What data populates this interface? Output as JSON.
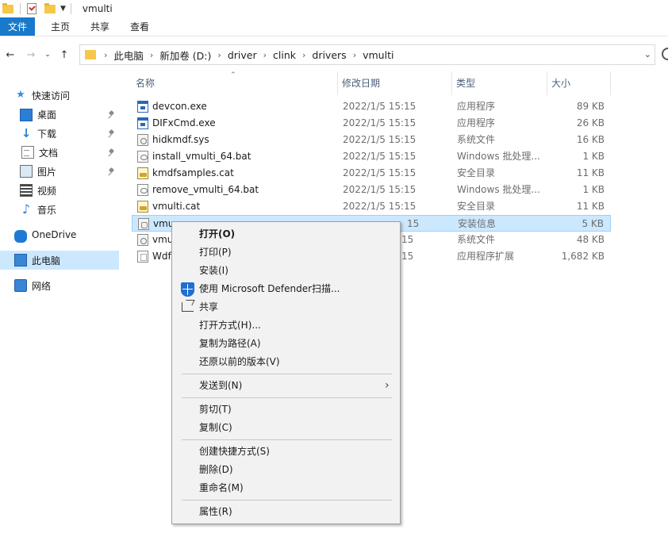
{
  "window": {
    "title": "vmulti"
  },
  "ribbon": {
    "tabs": [
      "文件",
      "主页",
      "共享",
      "查看"
    ]
  },
  "address": {
    "crumbs": [
      "此电脑",
      "新加卷 (D:)",
      "driver",
      "clink",
      "drivers",
      "vmulti"
    ]
  },
  "sidebar": {
    "quick_access": "快速访问",
    "items": [
      "桌面",
      "下载",
      "文档",
      "图片",
      "视频",
      "音乐"
    ],
    "onedrive": "OneDrive",
    "this_pc": "此电脑",
    "network": "网络"
  },
  "columns": {
    "name": "名称",
    "date": "修改日期",
    "type": "类型",
    "size": "大小"
  },
  "files": [
    {
      "name": "devcon.exe",
      "date": "2022/1/5 15:15",
      "type": "应用程序",
      "size": "89 KB",
      "icon": "exe-icon"
    },
    {
      "name": "DIFxCmd.exe",
      "date": "2022/1/5 15:15",
      "type": "应用程序",
      "size": "26 KB",
      "icon": "exe-icon"
    },
    {
      "name": "hidkmdf.sys",
      "date": "2022/1/5 15:15",
      "type": "系统文件",
      "size": "16 KB",
      "icon": "sys-icon"
    },
    {
      "name": "install_vmulti_64.bat",
      "date": "2022/1/5 15:15",
      "type": "Windows 批处理...",
      "size": "1 KB",
      "icon": "bat-icon"
    },
    {
      "name": "kmdfsamples.cat",
      "date": "2022/1/5 15:15",
      "type": "安全目录",
      "size": "11 KB",
      "icon": "cat-icon"
    },
    {
      "name": "remove_vmulti_64.bat",
      "date": "2022/1/5 15:15",
      "type": "Windows 批处理...",
      "size": "1 KB",
      "icon": "bat-icon"
    },
    {
      "name": "vmulti.cat",
      "date": "2022/1/5 15:15",
      "type": "安全目录",
      "size": "11 KB",
      "icon": "cat-icon"
    },
    {
      "name": "vmu",
      "date": "15",
      "type": "安装信息",
      "size": "5 KB",
      "icon": "inf-icon"
    },
    {
      "name": "vmu",
      "date": "15",
      "type": "系统文件",
      "size": "48 KB",
      "icon": "sys-icon"
    },
    {
      "name": "Wdf",
      "date": "15",
      "type": "应用程序扩展",
      "size": "1,682 KB",
      "icon": "dll-icon"
    }
  ],
  "context_menu": {
    "open": "打开(O)",
    "print": "打印(P)",
    "install": "安装(I)",
    "defender": "使用 Microsoft Defender扫描...",
    "share": "共享",
    "open_with": "打开方式(H)...",
    "copy_path": "复制为路径(A)",
    "restore": "还原以前的版本(V)",
    "send_to": "发送到(N)",
    "cut": "剪切(T)",
    "copy": "复制(C)",
    "create_shortcut": "创建快捷方式(S)",
    "delete": "删除(D)",
    "rename": "重命名(M)",
    "properties": "属性(R)"
  },
  "colors": {
    "accent": "#1979ca",
    "selection": "#cce8ff"
  }
}
